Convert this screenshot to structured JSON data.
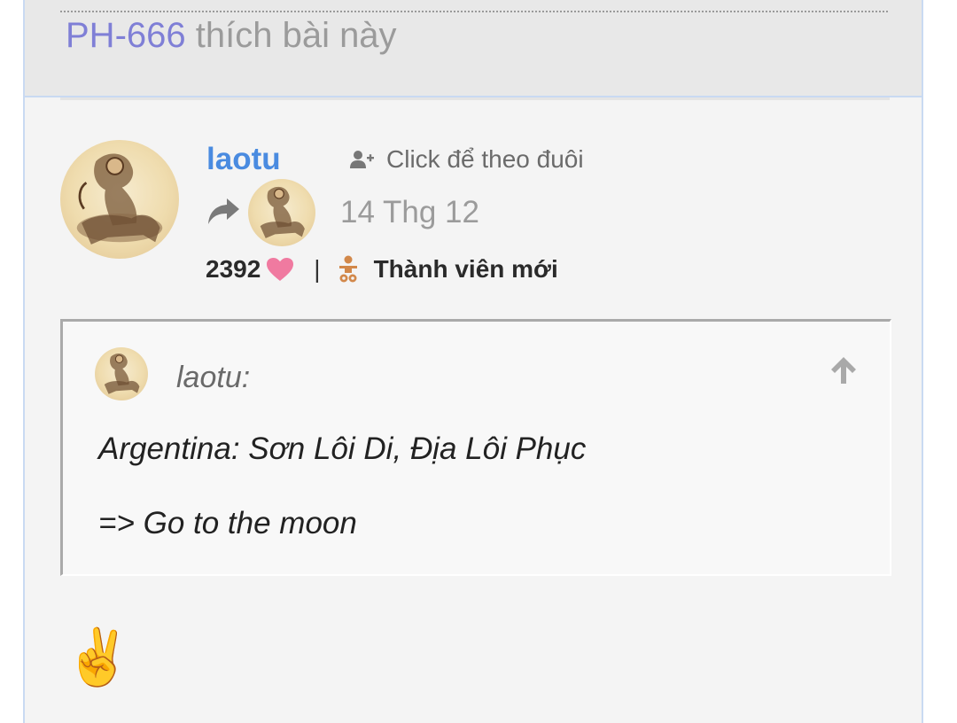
{
  "like_notice": {
    "user": "PH-666",
    "text": " thích bài này"
  },
  "post": {
    "username": "laotu",
    "follow_label": "Click để theo đuôi",
    "date": "14 Thg 12",
    "likes_count": "2392",
    "rank": "Thành viên mới",
    "quote": {
      "author": "laotu:",
      "line1": "Argentina: Sơn Lôi Di, Địa Lôi Phục",
      "line2": "=> Go to the moon"
    },
    "message_emoji": "✌️"
  },
  "icons": {
    "follow": "user-plus-icon",
    "share": "share-arrow-icon",
    "heart": "heart-icon",
    "rank": "baby-icon",
    "jump_to_quote": "arrow-up-icon"
  },
  "colors": {
    "username": "#4a8be0",
    "liker": "#7f7fd6",
    "heart": "#f07aa0",
    "rank_icon": "#d2884a",
    "border": "#c9daf2"
  }
}
